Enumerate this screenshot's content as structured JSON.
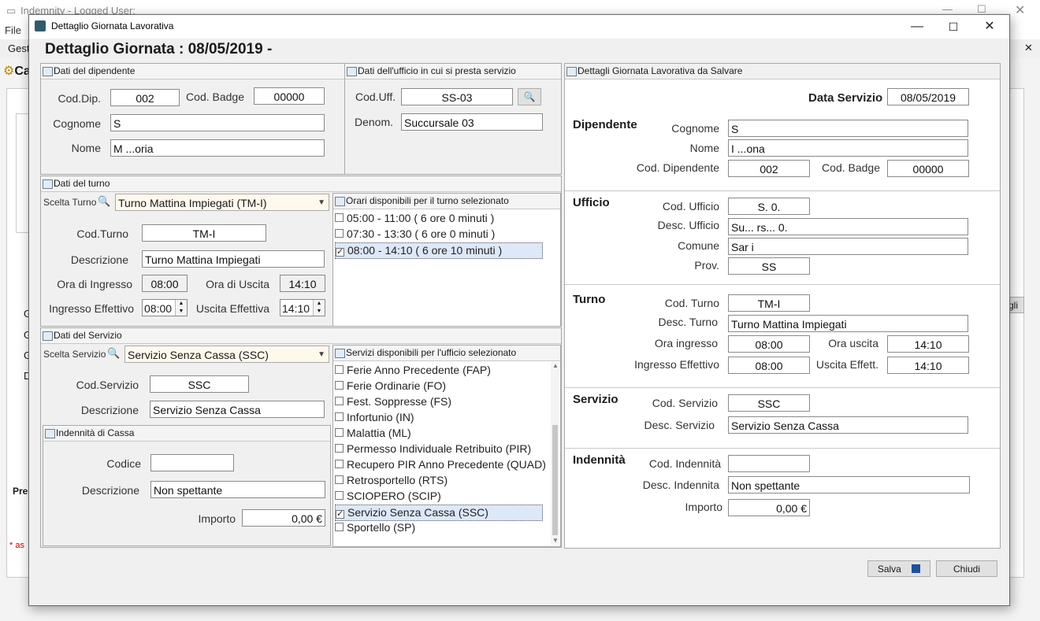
{
  "background_app": {
    "window_title": "Indemnity - Logged User:",
    "menu_file": "File",
    "tab_partial": "Gest",
    "tab_partial2": "Ca",
    "side_letters": [
      "G",
      "G",
      "G",
      "D"
    ],
    "btn_partial": "gli",
    "prev_partial": "Pre",
    "asterisk_note": "* as"
  },
  "dialog": {
    "title": "Dettaglio Giornata Lavorativa",
    "header": "Dettaglio Giornata : 08/05/2019  -",
    "header_redacted": "REDACTED NAME"
  },
  "employee": {
    "title": "Dati del dipendente",
    "cod_dip_label": "Cod.Dip.",
    "cod_dip": "002",
    "cod_badge_label": "Cod. Badge",
    "cod_badge": "00000",
    "cognome_label": "Cognome",
    "cognome": "S",
    "nome_label": "Nome",
    "nome": "M         ...oria"
  },
  "office": {
    "title": "Dati dell'ufficio in cui si presta servizio",
    "cod_uff_label": "Cod.Uff.",
    "cod_uff": "SS-03",
    "denom_label": "Denom.",
    "denom": "Succursale 03"
  },
  "shift": {
    "title": "Dati del turno",
    "scelta_label": "Scelta Turno",
    "scelta_value": "Turno Mattina Impiegati  (TM-I)",
    "cod_label": "Cod.Turno",
    "cod": "TM-I",
    "desc_label": "Descrizione",
    "desc": "Turno Mattina Impiegati",
    "ingresso_label": "Ora di Ingresso",
    "ingresso": "08:00",
    "uscita_label": "Ora di Uscita",
    "uscita": "14:10",
    "ing_eff_label": "Ingresso Effettivo",
    "ing_eff": "08:00",
    "usc_eff_label": "Uscita Effettiva",
    "usc_eff": "14:10"
  },
  "hours": {
    "title": "Orari disponibili per il turno selezionato",
    "items": [
      {
        "label": "05:00 - 11:00  ( 6 ore 0 minuti )",
        "checked": false
      },
      {
        "label": "07:30 - 13:30  ( 6 ore 0 minuti )",
        "checked": false
      },
      {
        "label": "08:00 - 14:10  ( 6 ore 10 minuti )",
        "checked": true
      }
    ]
  },
  "service": {
    "title": "Dati del Servizio",
    "scelta_label": "Scelta Servizio",
    "scelta_value": "Servizio Senza Cassa  (SSC)",
    "cod_label": "Cod.Servizio",
    "cod": "SSC",
    "desc_label": "Descrizione",
    "desc": "Servizio Senza Cassa"
  },
  "indemnity": {
    "title": "Indennità di Cassa",
    "codice_label": "Codice",
    "codice": "",
    "desc_label": "Descrizione",
    "desc": "Non spettante",
    "importo_label": "Importo",
    "importo": "0,00 €"
  },
  "services_list": {
    "title": "Servizi disponibili per l'ufficio selezionato",
    "items": [
      {
        "label": "Ferie Anno Precedente  (FAP)",
        "checked": false
      },
      {
        "label": "Ferie Ordinarie  (FO)",
        "checked": false
      },
      {
        "label": "Fest. Soppresse  (FS)",
        "checked": false
      },
      {
        "label": "Infortunio  (IN)",
        "checked": false
      },
      {
        "label": "Malattia  (ML)",
        "checked": false
      },
      {
        "label": "Permesso Individuale Retribuito  (PIR)",
        "checked": false
      },
      {
        "label": "Recupero PIR Anno Precedente  (QUAD)",
        "checked": false
      },
      {
        "label": "Retrosportello  (RTS)",
        "checked": false
      },
      {
        "label": "SCIOPERO  (SCIP)",
        "checked": false
      },
      {
        "label": "Servizio Senza Cassa  (SSC)",
        "checked": true
      },
      {
        "label": "Sportello  (SP)",
        "checked": false
      }
    ]
  },
  "summary": {
    "title": "Dettagli Giornata Lavorativa da Salvare",
    "data_servizio_label": "Data Servizio",
    "data_servizio": "08/05/2019",
    "dip_section": "Dipendente",
    "cognome_label": "Cognome",
    "cognome": "S",
    "nome_label": "Nome",
    "nome": "I          ...ona",
    "cod_dip_label": "Cod. Dipendente",
    "cod_dip": "002",
    "cod_badge_label": "Cod. Badge",
    "cod_badge": "00000",
    "uff_section": "Ufficio",
    "cod_uff_label": "Cod. Ufficio",
    "cod_uff": "S.  0.",
    "desc_uff_label": "Desc. Ufficio",
    "desc_uff": "Su... rs... 0.",
    "comune_label": "Comune",
    "comune": "Sar     i",
    "prov_label": "Prov.",
    "prov": "SS",
    "turno_section": "Turno",
    "cod_turno_label": "Cod. Turno",
    "cod_turno": "TM-I",
    "desc_turno_label": "Desc. Turno",
    "desc_turno": "Turno Mattina Impiegati",
    "ora_ing_label": "Ora ingresso",
    "ora_ing": "08:00",
    "ora_usc_label": "Ora uscita",
    "ora_usc": "14:10",
    "ing_eff_label": "Ingresso Effettivo",
    "ing_eff": "08:00",
    "usc_eff_label": "Uscita Effett.",
    "usc_eff": "14:10",
    "serv_section": "Servizio",
    "cod_serv_label": "Cod. Servizio",
    "cod_serv": "SSC",
    "desc_serv_label": "Desc. Servizio",
    "desc_serv": "Servizio Senza Cassa",
    "ind_section": "Indennità",
    "cod_ind_label": "Cod. Indennità",
    "cod_ind": "",
    "desc_ind_label": "Desc. Indennita",
    "desc_ind": "Non spettante",
    "importo_label": "Importo",
    "importo": "0,00 €"
  },
  "buttons": {
    "save": "Salva",
    "close": "Chiudi"
  }
}
